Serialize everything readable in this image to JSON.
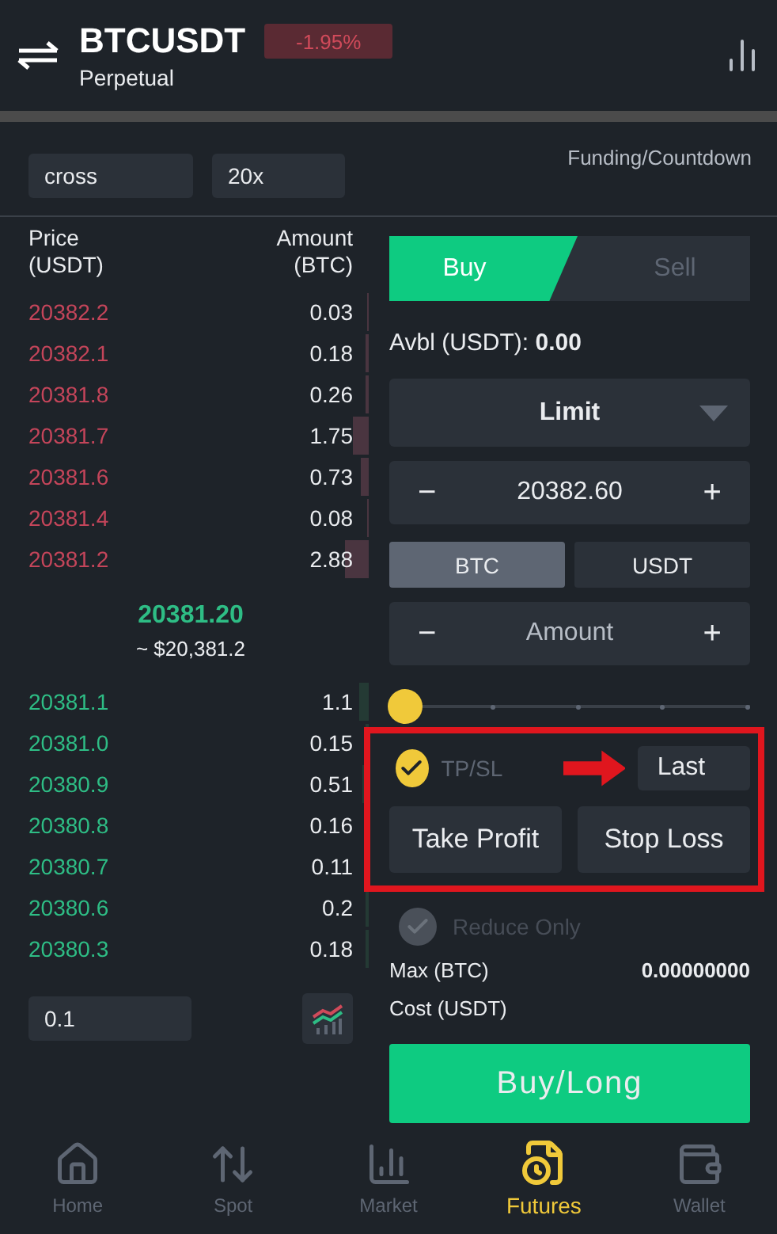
{
  "header": {
    "symbol": "BTCUSDT",
    "contract": "Perpetual",
    "change": "-1.95%"
  },
  "settings": {
    "margin_mode": "cross",
    "leverage": "20x",
    "funding": "Funding/Countdown"
  },
  "order_book": {
    "price_header": [
      "Price",
      "(USDT)"
    ],
    "amount_header": [
      "Amount",
      "(BTC)"
    ],
    "asks": [
      {
        "price": "20382.2",
        "amount": "0.03"
      },
      {
        "price": "20382.1",
        "amount": "0.18"
      },
      {
        "price": "20381.8",
        "amount": "0.26"
      },
      {
        "price": "20381.7",
        "amount": "1.75"
      },
      {
        "price": "20381.6",
        "amount": "0.73"
      },
      {
        "price": "20381.4",
        "amount": "0.08"
      },
      {
        "price": "20381.2",
        "amount": "2.88"
      }
    ],
    "last_price": "20381.20",
    "last_price_usd": "~ $20,381.2",
    "bids": [
      {
        "price": "20381.1",
        "amount": "1.1"
      },
      {
        "price": "20381.0",
        "amount": "0.15"
      },
      {
        "price": "20380.9",
        "amount": "0.51"
      },
      {
        "price": "20380.8",
        "amount": "0.16"
      },
      {
        "price": "20380.7",
        "amount": "0.11"
      },
      {
        "price": "20380.6",
        "amount": "0.2"
      },
      {
        "price": "20380.3",
        "amount": "0.18"
      }
    ],
    "step": "0.1"
  },
  "order_form": {
    "sides": [
      {
        "label": "Buy",
        "selected": true
      },
      {
        "label": "Sell",
        "selected": false
      }
    ],
    "available_label": "Avbl (USDT):",
    "available_value": "0.00",
    "order_type": "Limit",
    "price": {
      "minus": "−",
      "value": "20382.60",
      "plus": "+"
    },
    "units": [
      {
        "label": "BTC",
        "selected": true
      },
      {
        "label": "USDT",
        "selected": false
      }
    ],
    "amount": {
      "minus": "−",
      "placeholder": "Amount",
      "plus": "+"
    },
    "slider": {
      "level": 0
    },
    "tpsl": {
      "label": "TP/SL",
      "checked": true,
      "trigger": "Last",
      "buttons": [
        "Take Profit",
        "Stop Loss"
      ]
    },
    "reduce_only": {
      "label": "Reduce Only",
      "checked": true,
      "disabled": true
    },
    "max_label": "Max (BTC)",
    "max_value": "0.00000000",
    "cost_label": "Cost (USDT)",
    "submit": "Buy/Long"
  },
  "nav": [
    {
      "label": "Home",
      "selected": false
    },
    {
      "label": "Spot",
      "selected": false
    },
    {
      "label": "Market",
      "selected": false
    },
    {
      "label": "Futures",
      "selected": true
    },
    {
      "label": "Wallet",
      "selected": false
    }
  ]
}
